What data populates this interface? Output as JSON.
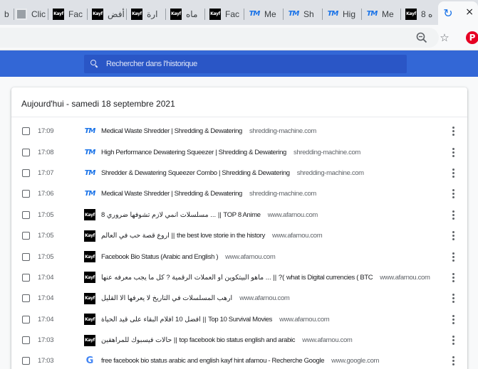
{
  "tabs": [
    {
      "favicon": "page-icon",
      "title": "b"
    },
    {
      "favicon": "image-icon",
      "title": "Clic"
    },
    {
      "favicon": "kayf-logo-icon",
      "title": "Fac"
    },
    {
      "favicon": "kayf-logo-icon",
      "title": "أفض"
    },
    {
      "favicon": "kayf-logo-icon",
      "title": "ارة"
    },
    {
      "favicon": "kayf-logo-icon",
      "title": "ماه"
    },
    {
      "favicon": "kayf-logo-icon",
      "title": "Fac"
    },
    {
      "favicon": "tm-logo-icon",
      "title": "Me"
    },
    {
      "favicon": "tm-logo-icon",
      "title": "Sh"
    },
    {
      "favicon": "tm-logo-icon",
      "title": "Hig"
    },
    {
      "favicon": "tm-logo-icon",
      "title": "Me"
    },
    {
      "favicon": "kayf-logo-icon",
      "title": "8 ه"
    }
  ],
  "active_tab": {
    "favicon": "history-icon",
    "close": "×"
  },
  "kayf_logo_text": "Kayf",
  "tm_logo_text": "TM",
  "google_logo_text": "G",
  "toolbar": {
    "zoom_icon": "zoom-out-icon",
    "star_icon": "star-icon",
    "extension_icon": "pinterest-icon",
    "pin_text": "P"
  },
  "search": {
    "placeholder": "Rechercher dans l'historique",
    "value": ""
  },
  "card": {
    "title": "Aujourd'hui - samedi 18 septembre 2021"
  },
  "entries": [
    {
      "time": "17:09",
      "favicon": "tm",
      "title": "Medical Waste Shredder | Shredding & Dewatering",
      "domain": "shredding-machine.com"
    },
    {
      "time": "17:08",
      "favicon": "tm",
      "title": "High Performance Dewatering Squeezer | Shredding & Dewatering",
      "domain": "shredding-machine.com"
    },
    {
      "time": "17:07",
      "favicon": "tm",
      "title": "Shredder & Dewatering Squeezer Combo | Shredding & Dewatering",
      "domain": "shredding-machine.com"
    },
    {
      "time": "17:06",
      "favicon": "tm",
      "title": "Medical Waste Shredder | Shredding & Dewatering",
      "domain": "shredding-machine.com"
    },
    {
      "time": "17:05",
      "favicon": "kayf",
      "title": "مسلسلات انمي لازم تشوفها ضروري 8 ... || TOP 8 Anime",
      "domain": "www.afarnou.com"
    },
    {
      "time": "17:05",
      "favicon": "kayf",
      "title": "اروع قصة حب في العالم || the best love storie in the history",
      "domain": "www.afarnou.com"
    },
    {
      "time": "17:05",
      "favicon": "kayf",
      "title": "Facebook Bio Status (Arabic and English )",
      "domain": "www.afarnou.com"
    },
    {
      "time": "17:04",
      "favicon": "kayf",
      "title": "ماهو البيتكوين او العملات الرقمية ? كل ما يجب معرفه عنها ... || ?( what is Digital currencies ( BTC",
      "domain": "www.afarnou.com"
    },
    {
      "time": "17:04",
      "favicon": "kayf",
      "title": "ارهب المسلسلات في التاريخ لا يعرفها الا القليل",
      "domain": "www.afarnou.com"
    },
    {
      "time": "17:04",
      "favicon": "kayf",
      "title": "افضل 10 افلام البقاء على قيد الحياة || Top 10 Survival Movies",
      "domain": "www.afarnou.com"
    },
    {
      "time": "17:03",
      "favicon": "kayf",
      "title": "حالات فيسبوك للمراهقين || top facebook bio status english and arabic",
      "domain": "www.afarnou.com"
    },
    {
      "time": "17:03",
      "favicon": "google",
      "title": "free facebook bio status arabic and english kayf hint afarnou - Recherche Google",
      "domain": "www.google.com"
    }
  ],
  "colors": {
    "header": "#3367d6",
    "accent": "#1a73e8",
    "tab_strip": "#dee1e6"
  }
}
